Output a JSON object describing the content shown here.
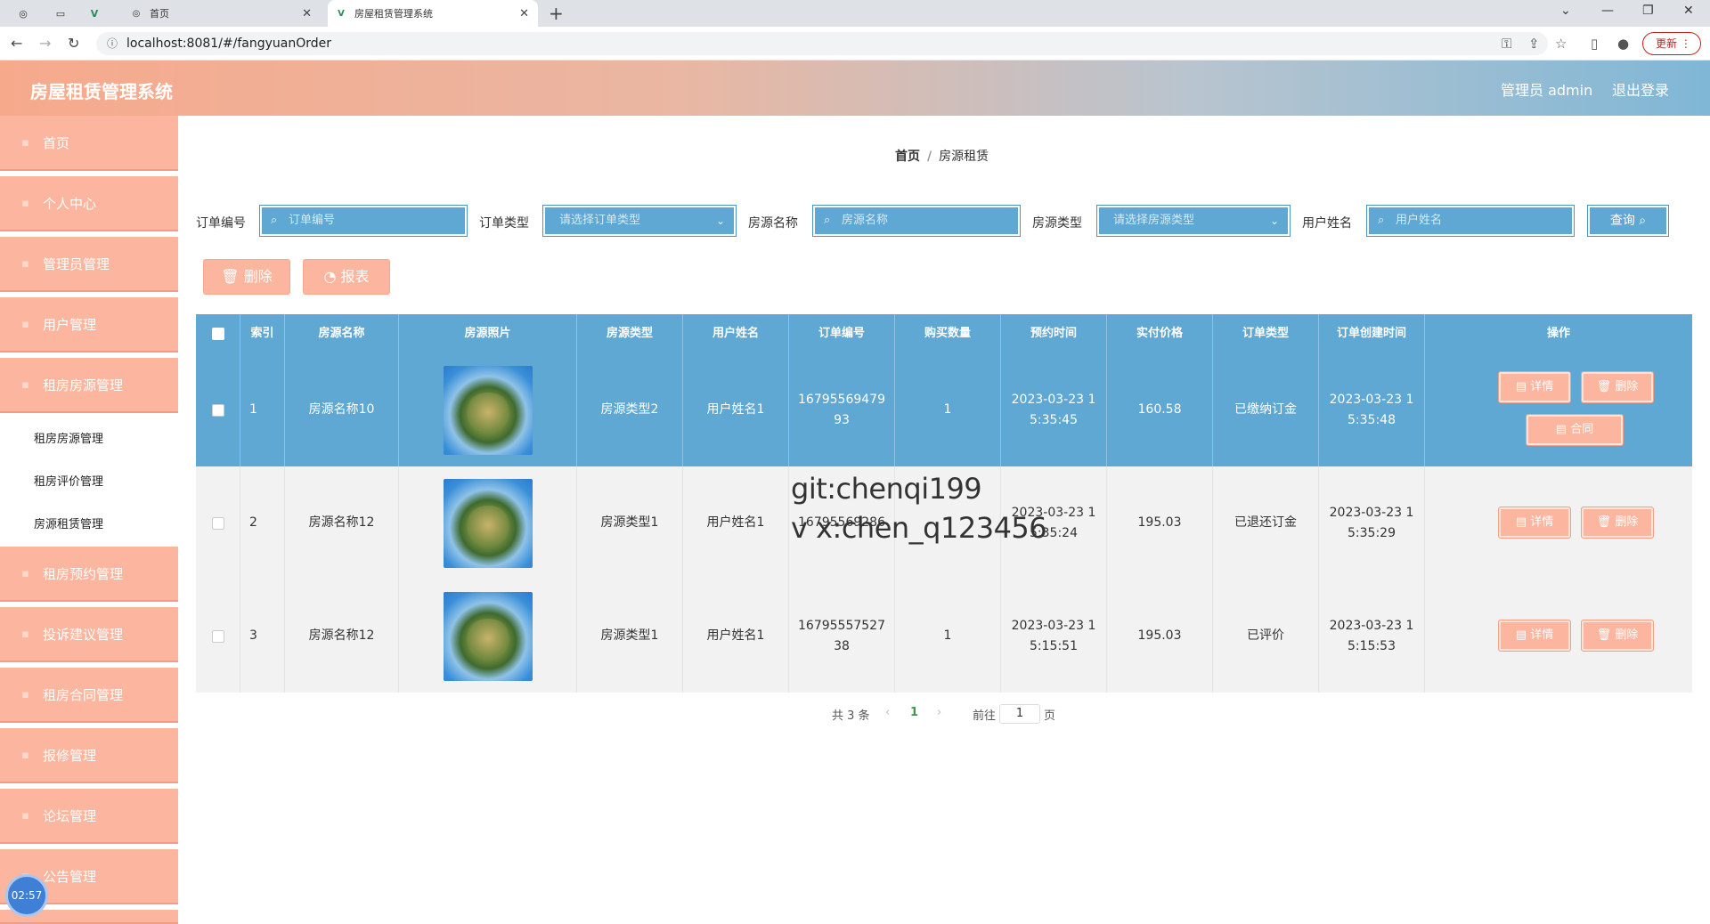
{
  "browser": {
    "tabs": [
      {
        "title": "首页"
      },
      {
        "title": "房屋租赁管理系统"
      }
    ],
    "url": "localhost:8081/#/fangyuanOrder",
    "update_label": "更新"
  },
  "header": {
    "title": "房屋租赁管理系统",
    "user": "管理员 admin",
    "logout": "退出登录"
  },
  "sidebar": {
    "items": [
      {
        "label": "首页"
      },
      {
        "label": "个人中心"
      },
      {
        "label": "管理员管理"
      },
      {
        "label": "用户管理"
      },
      {
        "label": "租房房源管理"
      },
      {
        "label": "租房预约管理"
      },
      {
        "label": "投诉建议管理"
      },
      {
        "label": "租房合同管理"
      },
      {
        "label": "报修管理"
      },
      {
        "label": "论坛管理"
      },
      {
        "label": "公告管理"
      }
    ],
    "subitems": [
      {
        "label": "租房房源管理"
      },
      {
        "label": "租房评价管理"
      },
      {
        "label": "房源租赁管理"
      }
    ],
    "timer": "02:57"
  },
  "breadcrumb": {
    "home": "首页",
    "current": "房源租赁"
  },
  "filters": {
    "order_no_label": "订单编号",
    "order_no_placeholder": "订单编号",
    "order_type_label": "订单类型",
    "order_type_placeholder": "请选择订单类型",
    "name_label": "房源名称",
    "name_placeholder": "房源名称",
    "type_label": "房源类型",
    "type_placeholder": "请选择房源类型",
    "user_label": "用户姓名",
    "user_placeholder": "用户姓名",
    "query_label": "查询"
  },
  "actions": {
    "delete": "删除",
    "report": "报表"
  },
  "table": {
    "headers": [
      "索引",
      "房源名称",
      "房源照片",
      "房源类型",
      "用户姓名",
      "订单编号",
      "购买数量",
      "预约时间",
      "实付价格",
      "订单类型",
      "订单创建时间",
      "操作"
    ],
    "rows": [
      {
        "index": "1",
        "name": "房源名称10",
        "type": "房源类型2",
        "user": "用户姓名1",
        "order_no_1": "16795569479",
        "order_no_2": "93",
        "qty": "1",
        "book_1": "2023-03-23 1",
        "book_2": "5:35:45",
        "price": "160.58",
        "order_type": "已缴纳订金",
        "created_1": "2023-03-23 1",
        "created_2": "5:35:48"
      },
      {
        "index": "2",
        "name": "房源名称12",
        "type": "房源类型1",
        "user": "用户姓名1",
        "order_no_1": "16795569286",
        "order_no_2": "",
        "qty": "",
        "book_1": "2023-03-23 1",
        "book_2": "5:35:24",
        "price": "195.03",
        "order_type": "已退还订金",
        "created_1": "2023-03-23 1",
        "created_2": "5:35:29"
      },
      {
        "index": "3",
        "name": "房源名称12",
        "type": "房源类型1",
        "user": "用户姓名1",
        "order_no_1": "16795557527",
        "order_no_2": "38",
        "qty": "1",
        "book_1": "2023-03-23 1",
        "book_2": "5:15:51",
        "price": "195.03",
        "order_type": "已评价",
        "created_1": "2023-03-23 1",
        "created_2": "5:15:53"
      }
    ],
    "op_detail": "详情",
    "op_delete": "删除",
    "op_contract": "合同"
  },
  "watermark": {
    "line1": "git:chenqi199",
    "line2": "v x:chen_q123456"
  },
  "pagination": {
    "total": "共 3 条",
    "current": "1",
    "goto": "前往",
    "page_input": "1",
    "page_unit": "页"
  },
  "colors": {
    "primary_blue": "#5fa8d3",
    "accent_salmon": "#fcb59e"
  }
}
